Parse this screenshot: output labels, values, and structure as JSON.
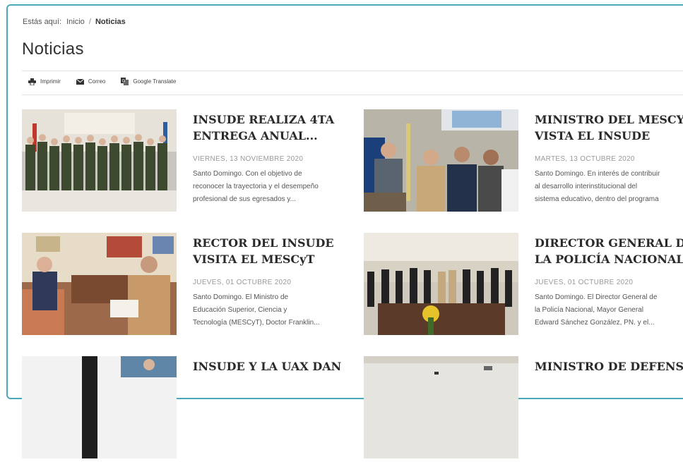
{
  "breadcrumb": {
    "prefix": "Estás aquí:",
    "home": "Inicio",
    "separator": "/",
    "current": "Noticias"
  },
  "page_title": "Noticias",
  "toolbar": {
    "print": {
      "label": "Imprimir",
      "icon": "printer-icon"
    },
    "email": {
      "label": "Correo",
      "icon": "envelope-icon"
    },
    "translate": {
      "label": "Google Translate",
      "icon": "translate-icon"
    }
  },
  "news": [
    {
      "title_lines": [
        "INSUDE REALIZA 4TA",
        "ENTREGA ANUAL..."
      ],
      "date": "VIERNES, 13 NOVIEMBRE 2020",
      "excerpt_lines": [
        "Santo Domingo. Con el objetivo de",
        "reconocer la trayectoria y el desempeño",
        "profesional de sus egresados y..."
      ]
    },
    {
      "title_lines": [
        "MINISTRO DEL MESCYT",
        "VISTA EL INSUDE"
      ],
      "date": "MARTES, 13 OCTUBRE 2020",
      "excerpt_lines": [
        "Santo Domingo. En interés de contribuir",
        "al desarrollo interinstitucional del",
        "sistema educativo, dentro del programa"
      ]
    },
    {
      "title_lines": [
        "RECTOR DEL INSUDE",
        "VISITA EL MESCyT"
      ],
      "date": "JUEVES, 01 OCTUBRE 2020",
      "excerpt_lines": [
        "Santo Domingo. El Ministro de",
        "Educación Superior, Ciencia y",
        "Tecnología (MESCyT), Doctor Franklin..."
      ]
    },
    {
      "title_lines": [
        "DIRECTOR GENERAL DE",
        "LA POLICÍA NACIONAL ..."
      ],
      "date": "JUEVES, 01 OCTUBRE 2020",
      "excerpt_lines": [
        "Santo Domingo. El Director General de",
        "la Policía Nacional, Mayor General",
        "Edward Sánchez González, PN. y el..."
      ]
    },
    {
      "title_lines": [
        "INSUDE Y LA UAX DAN"
      ]
    },
    {
      "title_lines": [
        "MINISTRO DE DEFENSA"
      ]
    }
  ]
}
